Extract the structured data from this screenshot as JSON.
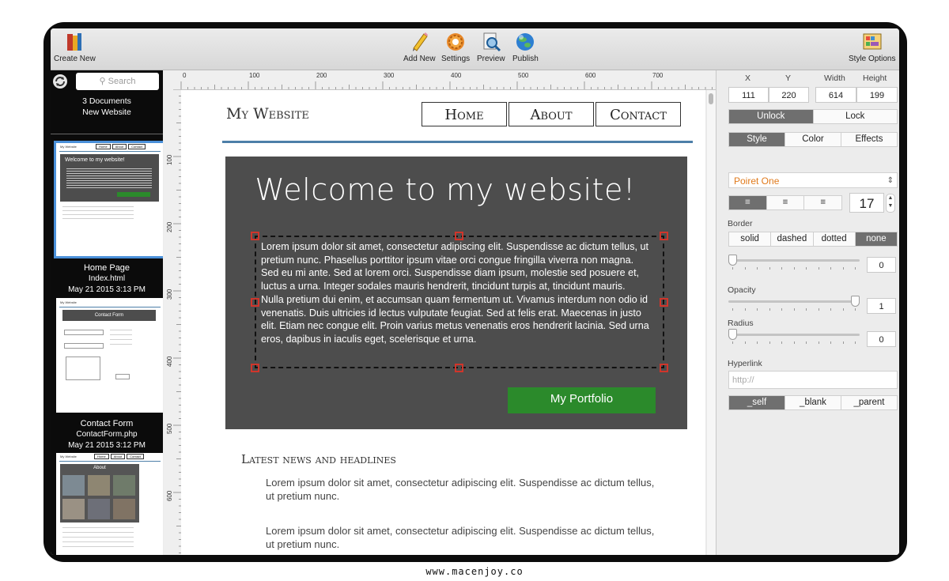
{
  "toolbar": {
    "create_new": "Create New",
    "add_new": "Add New",
    "settings": "Settings",
    "preview": "Preview",
    "publish": "Publish",
    "style_options": "Style Options"
  },
  "sidebar": {
    "search_placeholder": "Search",
    "doc_count": "3 Documents",
    "site_name": "New Website",
    "pages": [
      {
        "title": "Home Page",
        "file": "Index.html",
        "date": "May 21 2015 3:13 PM"
      },
      {
        "title": "Contact Form",
        "file": "ContactForm.php",
        "date": "May 21 2015 3:12 PM"
      }
    ]
  },
  "ruler": {
    "top": [
      "0",
      "100",
      "200",
      "300",
      "400",
      "500",
      "600",
      "700"
    ],
    "left": [
      "100",
      "200",
      "300",
      "400",
      "500",
      "600"
    ]
  },
  "site": {
    "logo": "My Website",
    "nav": [
      "Home",
      "About",
      "Contact"
    ],
    "hero_title": "Welcome to my website!",
    "hero_body": "Lorem ipsum dolor sit amet, consectetur adipiscing elit. Suspendisse ac dictum tellus, ut pretium nunc. Phasellus porttitor ipsum vitae orci congue fringilla viverra non magna. Sed eu mi ante. Sed at lorem orci. Suspendisse diam ipsum, molestie sed posuere et, luctus a urna. Integer sodales mauris hendrerit, tincidunt turpis at, tincidunt mauris. Nulla pretium dui enim, et accumsan quam fermentum ut. Vivamus interdum non odio id venenatis. Duis ultricies id lectus vulputate feugiat. Sed at felis erat. Maecenas in justo elit. Etiam nec congue elit. Proin varius metus venenatis eros hendrerit lacinia. Sed urna eros, dapibus in iaculis eget, scelerisque et urna.",
    "portfolio_button": "My Portfolio",
    "news_heading": "Latest news and headlines",
    "news_items": [
      "Lorem ipsum dolor sit amet, consectetur adipiscing elit. Suspendisse ac dictum tellus, ut pretium nunc.",
      "Lorem ipsum dolor sit amet, consectetur adipiscing elit. Suspendisse ac dictum tellus, ut pretium nunc."
    ]
  },
  "thumbs": {
    "home_logo": "My Website",
    "home_nav": [
      "Home",
      "About",
      "Contact"
    ],
    "home_banner": "Welcome to my website!",
    "contact_logo": "My Website",
    "contact_title": "Contact Form",
    "about_logo": "My Website",
    "about_nav": [
      "Home",
      "About",
      "Contact"
    ],
    "about_title": "About"
  },
  "inspector": {
    "labels": {
      "x": "X",
      "y": "Y",
      "width": "Width",
      "height": "Height"
    },
    "values": {
      "x": "111",
      "y": "220",
      "width": "614",
      "height": "199"
    },
    "lock": {
      "options": [
        "Unlock",
        "Lock"
      ],
      "selected": "Unlock"
    },
    "tabs": {
      "options": [
        "Style",
        "Color",
        "Effects"
      ],
      "selected": "Style"
    },
    "font": "Poiret One",
    "font_size": "17",
    "border_label": "Border",
    "border_styles": [
      "solid",
      "dashed",
      "dotted",
      "none"
    ],
    "border_selected": "none",
    "border_value": "0",
    "opacity_label": "Opacity",
    "opacity_value": "1",
    "radius_label": "Radius",
    "radius_value": "0",
    "hyperlink_label": "Hyperlink",
    "hyperlink_placeholder": "http://",
    "targets": [
      "_self",
      "_blank",
      "_parent"
    ],
    "target_selected": "_self"
  },
  "footer": "www.macenjoy.co",
  "colors": {
    "hero_bg": "#4d4d4d",
    "accent_line": "#4d7fa8",
    "portfolio_green": "#2b8a2b",
    "handle_red": "#d0352b",
    "font_orange": "#e07a1c",
    "selected_segment": "#6f6f6f"
  }
}
